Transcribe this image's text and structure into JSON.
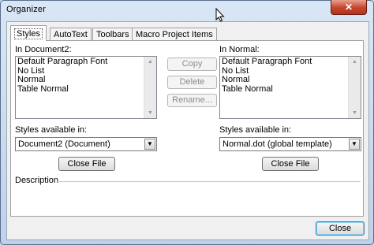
{
  "window": {
    "title": "Organizer",
    "close_glyph": "✕"
  },
  "tabs": [
    {
      "label": "Styles",
      "active": true
    },
    {
      "label": "AutoText",
      "active": false
    },
    {
      "label": "Toolbars",
      "active": false
    },
    {
      "label": "Macro Project Items",
      "active": false
    }
  ],
  "left": {
    "list_label": "In Document2:",
    "items": [
      "Default Paragraph Font",
      "No List",
      "Normal",
      "Table Normal"
    ],
    "available_label": "Styles available in:",
    "available_value": "Document2 (Document)",
    "close_file_label": "Close File"
  },
  "right": {
    "list_label": "In Normal:",
    "items": [
      "Default Paragraph Font",
      "No List",
      "Normal",
      "Table Normal"
    ],
    "available_label": "Styles available in:",
    "available_value": "Normal.dot (global template)",
    "close_file_label": "Close File"
  },
  "actions": {
    "copy": "Copy",
    "delete": "Delete",
    "rename": "Rename..."
  },
  "description_label": "Description",
  "footer": {
    "close_label": "Close"
  }
}
